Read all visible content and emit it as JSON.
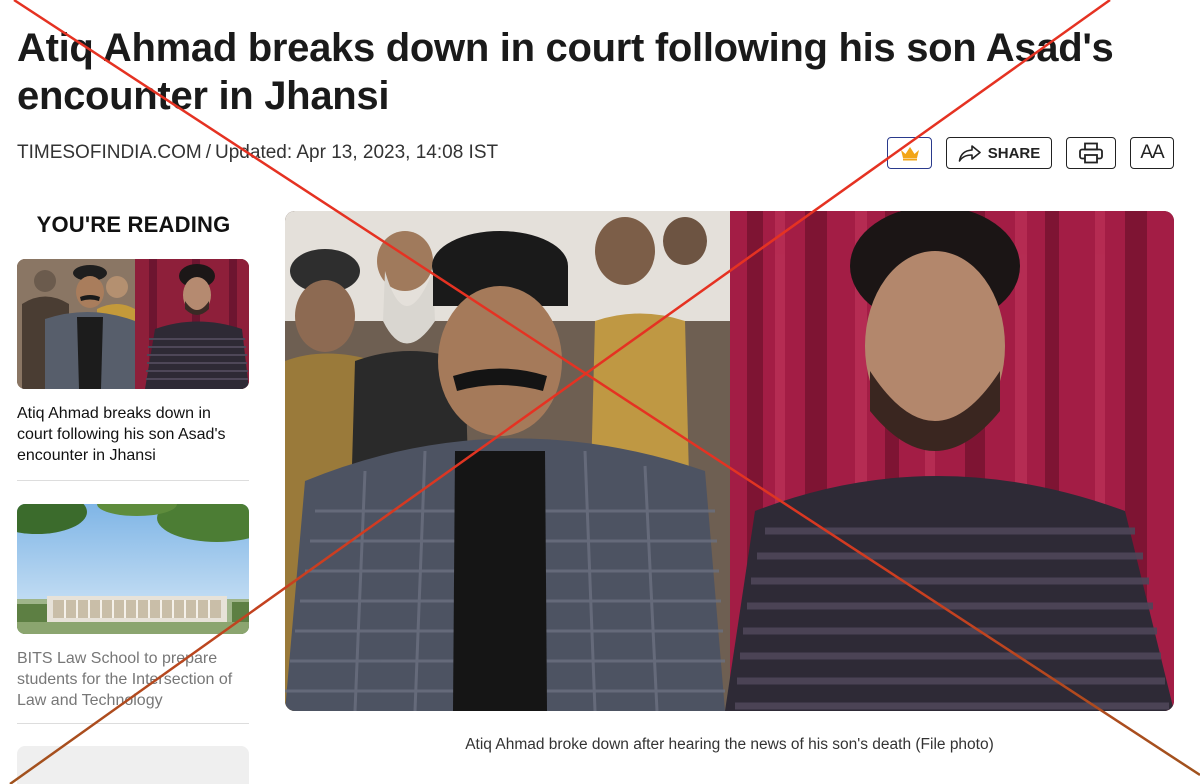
{
  "article": {
    "headline": "Atiq Ahmad breaks down in court following his son Asad's encounter in Jhansi",
    "source": "TIMESOFINDIA.COM",
    "separator": "/",
    "updated": "Updated: Apr 13, 2023, 14:08 IST",
    "image_caption": "Atiq Ahmad broke down after hearing the news of his son's death (File photo)"
  },
  "toolbar": {
    "crown_icon": "crown-icon",
    "share_label": "SHARE",
    "share_icon": "share-arrow-icon",
    "print_icon": "printer-icon",
    "font_size_label": "AA"
  },
  "sidebar": {
    "heading": "YOU'RE READING",
    "cards": [
      {
        "title": "Atiq Ahmad breaks down in court following his son Asad's encounter in Jhansi"
      },
      {
        "title": "BITS Law School to prepare students for the Intersection of Law and Technology"
      }
    ]
  },
  "overlay": {
    "cross_color": "#e53222",
    "cross_color_lower": "#a0521d"
  }
}
